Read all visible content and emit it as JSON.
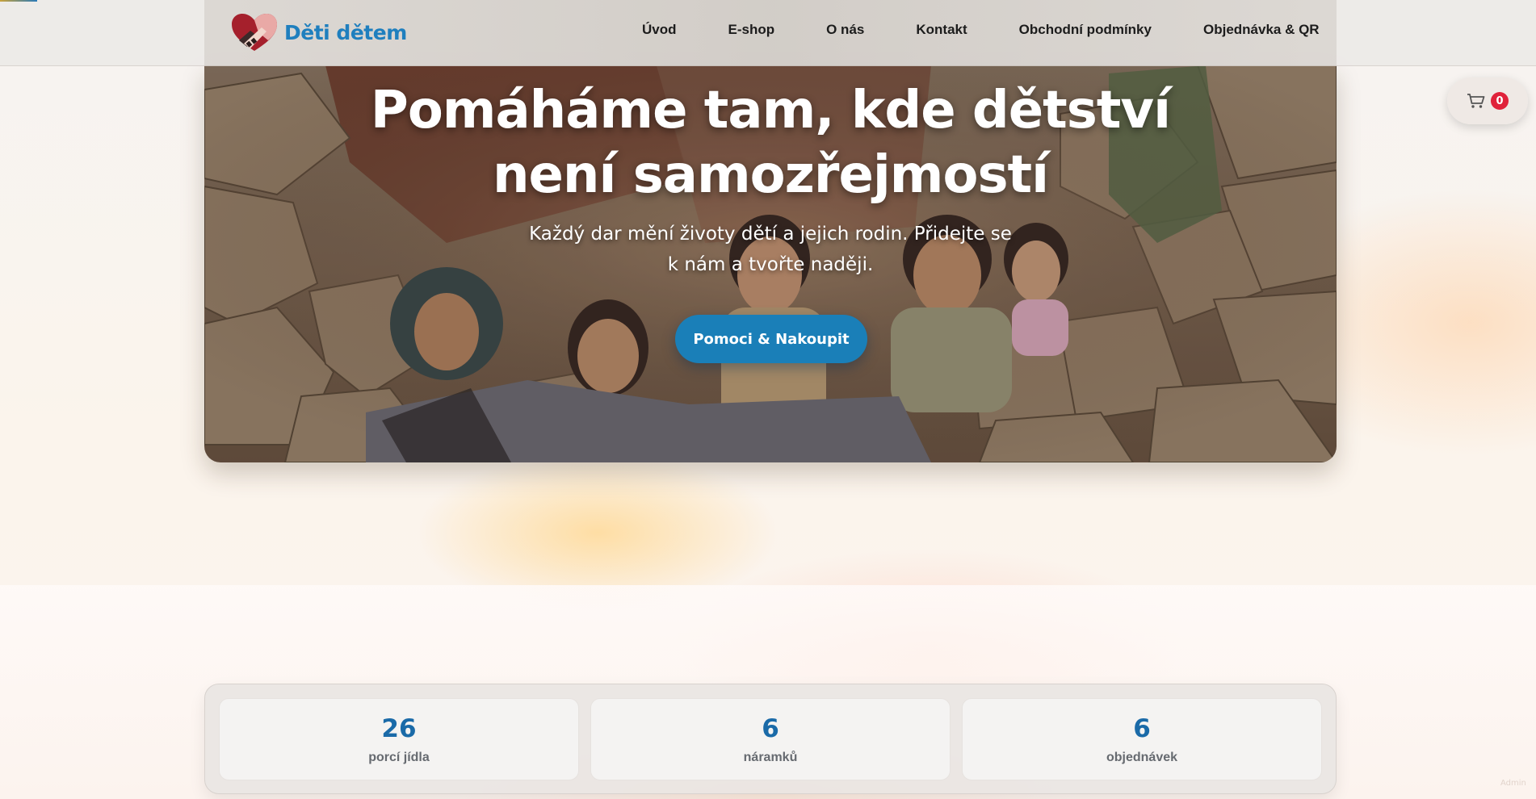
{
  "brand": {
    "name": "Děti dětem",
    "logo_icon": "heart-handshake-icon"
  },
  "nav": {
    "items": [
      {
        "label": "Úvod"
      },
      {
        "label": "E-shop"
      },
      {
        "label": "O nás"
      },
      {
        "label": "Kontakt"
      },
      {
        "label": "Obchodní podmínky"
      },
      {
        "label": "Objednávka & QR"
      }
    ]
  },
  "cart": {
    "icon": "cart-icon",
    "count": "0"
  },
  "hero": {
    "title": "Pomáháme tam, kde dětství není samozřejmostí",
    "subtitle": "Každý dar mění životy dětí a jejich rodin. Přidejte se k nám a tvořte naději.",
    "cta_label": "Pomoci & Nakoupit",
    "image": "children-in-village-photo"
  },
  "stats": [
    {
      "value": "26",
      "label": "porcí jídla"
    },
    {
      "value": "6",
      "label": "náramků"
    },
    {
      "value": "6",
      "label": "objednávek"
    }
  ],
  "footer": {
    "admin_label": "Admin"
  },
  "colors": {
    "accent": "#1a7fb8",
    "brand_text": "#1f7fbe",
    "badge": "#e0223a",
    "logo_heart": "#a5202c"
  }
}
